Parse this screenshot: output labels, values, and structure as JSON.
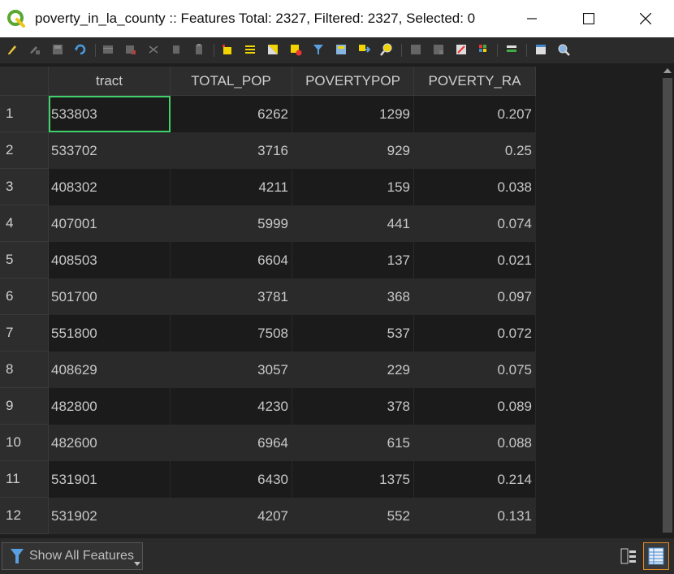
{
  "window": {
    "title": "poverty_in_la_county :: Features Total: 2327, Filtered: 2327, Selected: 0"
  },
  "toolbar": {
    "icons": [
      "pencil-icon",
      "multi-edit-icon",
      "save-icon",
      "reload-icon",
      "add-feature-icon",
      "delete-feature-icon",
      "cut-icon",
      "copy-icon",
      "paste-icon",
      "select-by-expression-icon",
      "select-all-icon",
      "invert-selection-icon",
      "deselect-icon",
      "filter-icon",
      "move-selection-top-icon",
      "pan-to-selection-icon",
      "zoom-to-selection-icon",
      "new-field-icon",
      "delete-field-icon",
      "field-calculator-icon",
      "conditional-formatting-icon",
      "actions-icon",
      "dock-icon",
      "zoom-icon"
    ]
  },
  "table": {
    "columns": [
      "tract",
      "TOTAL_POP",
      "POVERTYPOP",
      "POVERTY_RA"
    ],
    "rows": [
      {
        "n": "1",
        "tract": "533803",
        "total": "6262",
        "pov": "1299",
        "ra": "0.207"
      },
      {
        "n": "2",
        "tract": "533702",
        "total": "3716",
        "pov": "929",
        "ra": "0.25"
      },
      {
        "n": "3",
        "tract": "408302",
        "total": "4211",
        "pov": "159",
        "ra": "0.038"
      },
      {
        "n": "4",
        "tract": "407001",
        "total": "5999",
        "pov": "441",
        "ra": "0.074"
      },
      {
        "n": "5",
        "tract": "408503",
        "total": "6604",
        "pov": "137",
        "ra": "0.021"
      },
      {
        "n": "6",
        "tract": "501700",
        "total": "3781",
        "pov": "368",
        "ra": "0.097"
      },
      {
        "n": "7",
        "tract": "551800",
        "total": "7508",
        "pov": "537",
        "ra": "0.072"
      },
      {
        "n": "8",
        "tract": "408629",
        "total": "3057",
        "pov": "229",
        "ra": "0.075"
      },
      {
        "n": "9",
        "tract": "482800",
        "total": "4230",
        "pov": "378",
        "ra": "0.089"
      },
      {
        "n": "10",
        "tract": "482600",
        "total": "6964",
        "pov": "615",
        "ra": "0.088"
      },
      {
        "n": "11",
        "tract": "531901",
        "total": "6430",
        "pov": "1375",
        "ra": "0.214"
      },
      {
        "n": "12",
        "tract": "531902",
        "total": "4207",
        "pov": "552",
        "ra": "0.131"
      }
    ]
  },
  "bottom": {
    "filter_label": "Show All Features"
  },
  "colors": {
    "selection_outline": "#3fd26b",
    "active_view_border": "#e58b1f",
    "qgis_green": "#4caf50"
  }
}
